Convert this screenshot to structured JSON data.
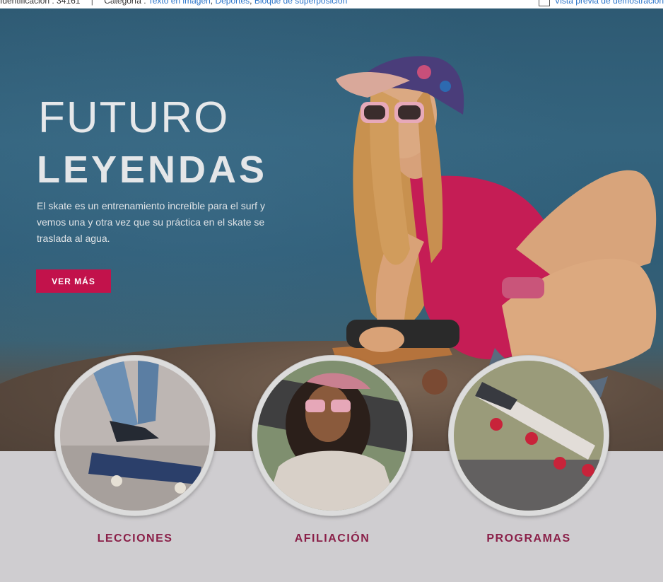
{
  "meta": {
    "id_text": "Identificación : 34161",
    "category_prefix": "Categoría :",
    "categories": [
      "Texto en imagen",
      "Deportes",
      "Bloque de superposición"
    ],
    "preview_label": "Vista previa de demostración"
  },
  "hero": {
    "title_line1": "FUTURO",
    "title_line2": "LEYENDAS",
    "description": "El skate es un entrenamiento increíble para el surf y vemos una y otra vez que su práctica en el skate se traslada al agua.",
    "button_label": "VER MÁS"
  },
  "cards": [
    {
      "label": "LECCIONES"
    },
    {
      "label": "AFILIACIÓN"
    },
    {
      "label": "PROGRAMAS"
    }
  ],
  "colors": {
    "accent": "#c2124b",
    "label": "#8a1f48",
    "bottom_bg": "#cfcdd0"
  }
}
